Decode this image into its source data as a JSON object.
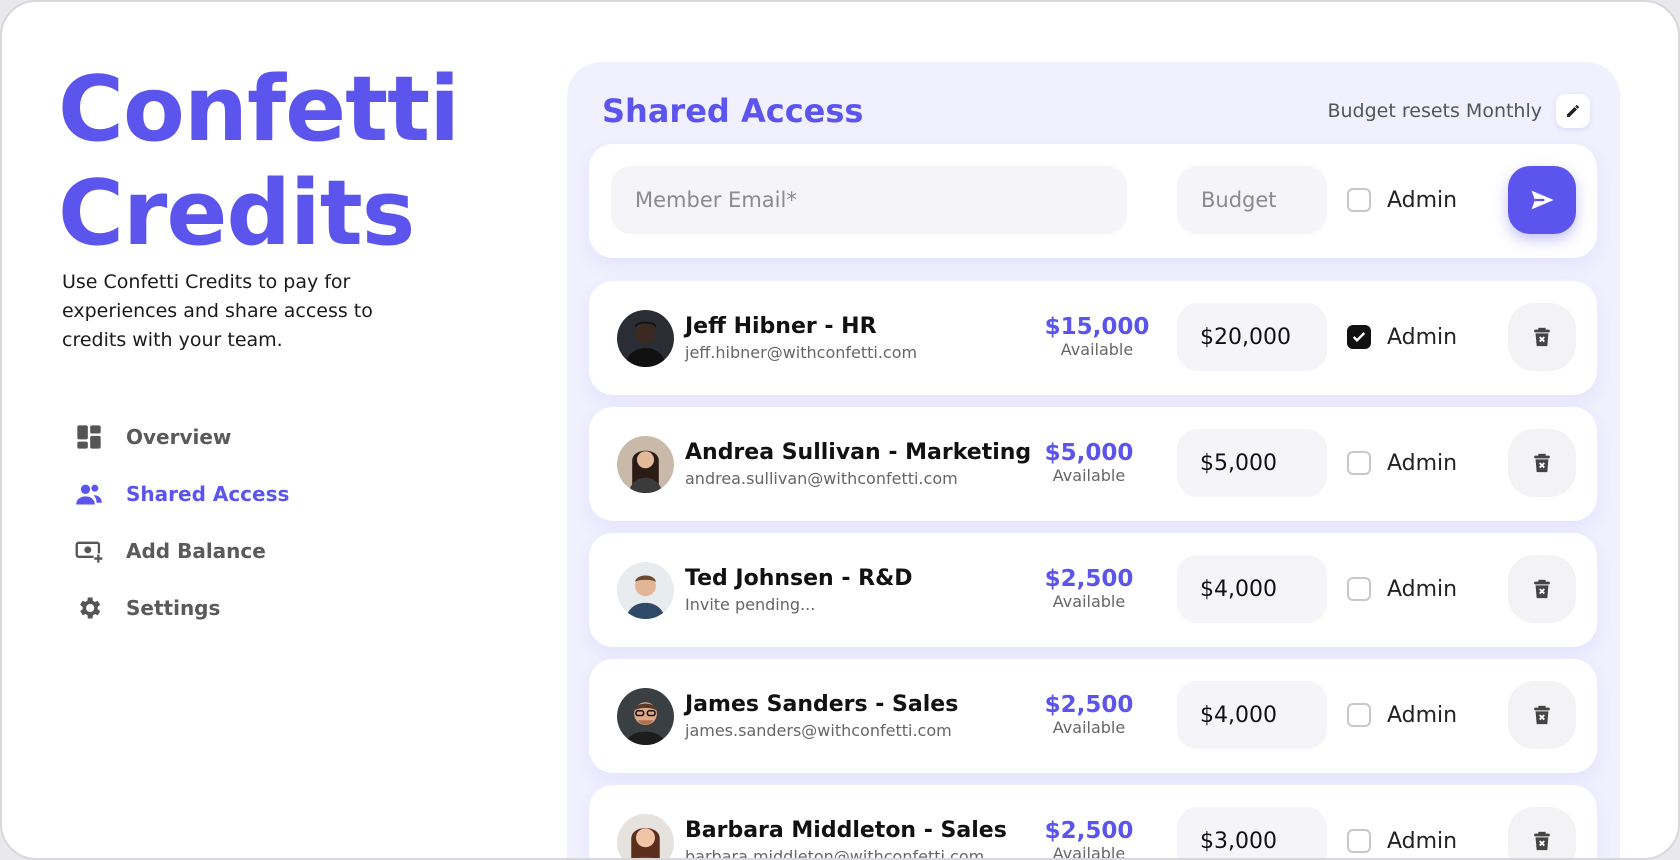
{
  "brand": {
    "line1": "Confetti",
    "line2": "Credits"
  },
  "intro": "Use Confetti Credits to pay for experiences and share access to credits with your team.",
  "nav": [
    {
      "label": "Overview",
      "icon": "dashboard-icon",
      "active": false
    },
    {
      "label": "Shared Access",
      "icon": "users-icon",
      "active": true
    },
    {
      "label": "Add Balance",
      "icon": "add-money-icon",
      "active": false
    },
    {
      "label": "Settings",
      "icon": "gear-icon",
      "active": false
    }
  ],
  "panel": {
    "title": "Shared Access",
    "budget_reset": "Budget resets Monthly"
  },
  "add_form": {
    "email_placeholder": "Member Email*",
    "budget_placeholder": "Budget",
    "admin_label": "Admin"
  },
  "members": [
    {
      "name": "Jeff Hibner - HR",
      "sub": "jeff.hibner@withconfetti.com",
      "available": "$15,000",
      "available_label": "Available",
      "budget": "$20,000",
      "admin": true,
      "admin_label": "Admin"
    },
    {
      "name": "Andrea Sullivan - Marketing",
      "sub": "andrea.sullivan@withconfetti.com",
      "available": "$5,000",
      "available_label": "Available",
      "budget": "$5,000",
      "admin": false,
      "admin_label": "Admin"
    },
    {
      "name": "Ted Johnsen - R&D",
      "sub": "Invite pending...",
      "available": "$2,500",
      "available_label": "Available",
      "budget": "$4,000",
      "admin": false,
      "admin_label": "Admin"
    },
    {
      "name": "James Sanders - Sales",
      "sub": "james.sanders@withconfetti.com",
      "available": "$2,500",
      "available_label": "Available",
      "budget": "$4,000",
      "admin": false,
      "admin_label": "Admin"
    },
    {
      "name": "Barbara Middleton - Sales",
      "sub": "barbara.middleton@withconfetti.com",
      "available": "$2,500",
      "available_label": "Available",
      "budget": "$3,000",
      "admin": false,
      "admin_label": "Admin"
    }
  ],
  "colors": {
    "accent": "#5b55ee",
    "panel_bg": "#f1f0fe",
    "field_bg": "#f5f4f8"
  }
}
